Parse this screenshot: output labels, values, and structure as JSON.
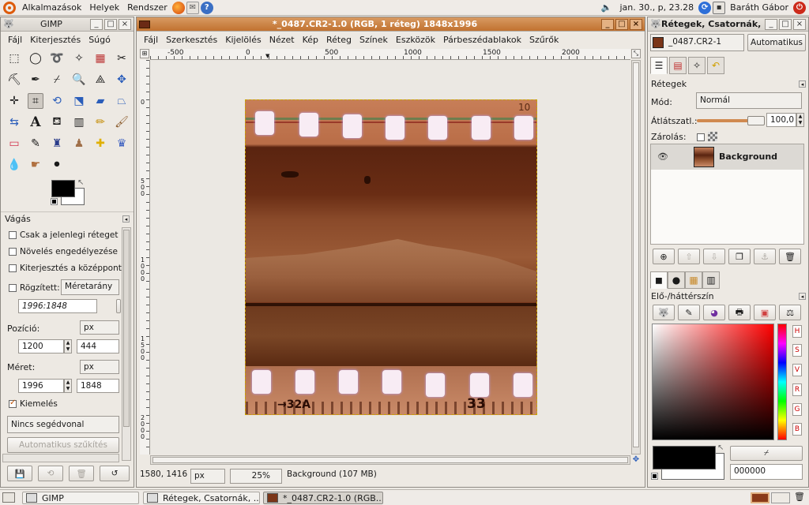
{
  "top_panel": {
    "menus": [
      "Alkalmazások",
      "Helyek",
      "Rendszer"
    ],
    "datetime": "jan. 30., p, 23.28",
    "user": "Baráth Gábor"
  },
  "toolbox": {
    "title": "GIMP",
    "menu": [
      "Fájl",
      "Kiterjesztés",
      "Súgó"
    ],
    "tool_options_title": "Vágás",
    "current_layer_only": "Csak a jelenlegi réteget",
    "allow_growing": "Növelés engedélyezése",
    "expand_from_center": "Kiterjesztés a középpont",
    "fixed": "Rögzített:",
    "fixed_mode": "Méretarány",
    "aspect_value": "1996:1848",
    "position_label": "Pozíció:",
    "pos_unit": "px",
    "pos_x": "1200",
    "pos_y": "444",
    "size_label": "Méret:",
    "size_unit": "px",
    "size_w": "1996",
    "size_h": "1848",
    "highlight": "Kiemelés",
    "guides": "Nincs segédvonal",
    "auto_shrink": "Automatikus szűkítés"
  },
  "image_window": {
    "title": "*_0487.CR2-1.0 (RGB, 1 réteg) 1848x1996",
    "menu": [
      "Fájl",
      "Szerkesztés",
      "Kijelölés",
      "Nézet",
      "Kép",
      "Réteg",
      "Színek",
      "Eszközök",
      "Párbeszédablakok",
      "Szűrők"
    ],
    "ruler_h": [
      "-500",
      "0",
      "500",
      "1000",
      "1500",
      "2000"
    ],
    "ruler_v": [
      "0",
      "5 0 0",
      "1 0 0 0",
      "1 5 0 0",
      "2 0 0 0"
    ],
    "coords": "1580, 1416",
    "unit": "px",
    "zoom": "25%",
    "status": "Background (107 MB)",
    "film_codes": [
      "→32A",
      "33",
      "10"
    ]
  },
  "layers_window": {
    "title": "Rétegek, Csatornák, ...",
    "image_selector": "_0487.CR2-1",
    "auto_button": "Automatikus",
    "panel_title": "Rétegek",
    "mode_label": "Mód:",
    "mode_value": "Normál",
    "opacity_label": "Átlátszatl.:",
    "opacity_value": "100,0",
    "lock_label": "Zárolás:",
    "layer_name": "Background",
    "fgbg_title": "Elő-/háttérszín",
    "hex_value": "000000",
    "channel_buttons": [
      "H",
      "S",
      "V",
      "R",
      "G",
      "B"
    ]
  },
  "taskbar": {
    "tasks": [
      "GIMP",
      "Rétegek, Csatornák, ...",
      "*_0487.CR2-1.0 (RGB..."
    ]
  },
  "colors": {
    "accent": "#c87a3a",
    "fg": "#000000",
    "bg": "#ffffff"
  }
}
